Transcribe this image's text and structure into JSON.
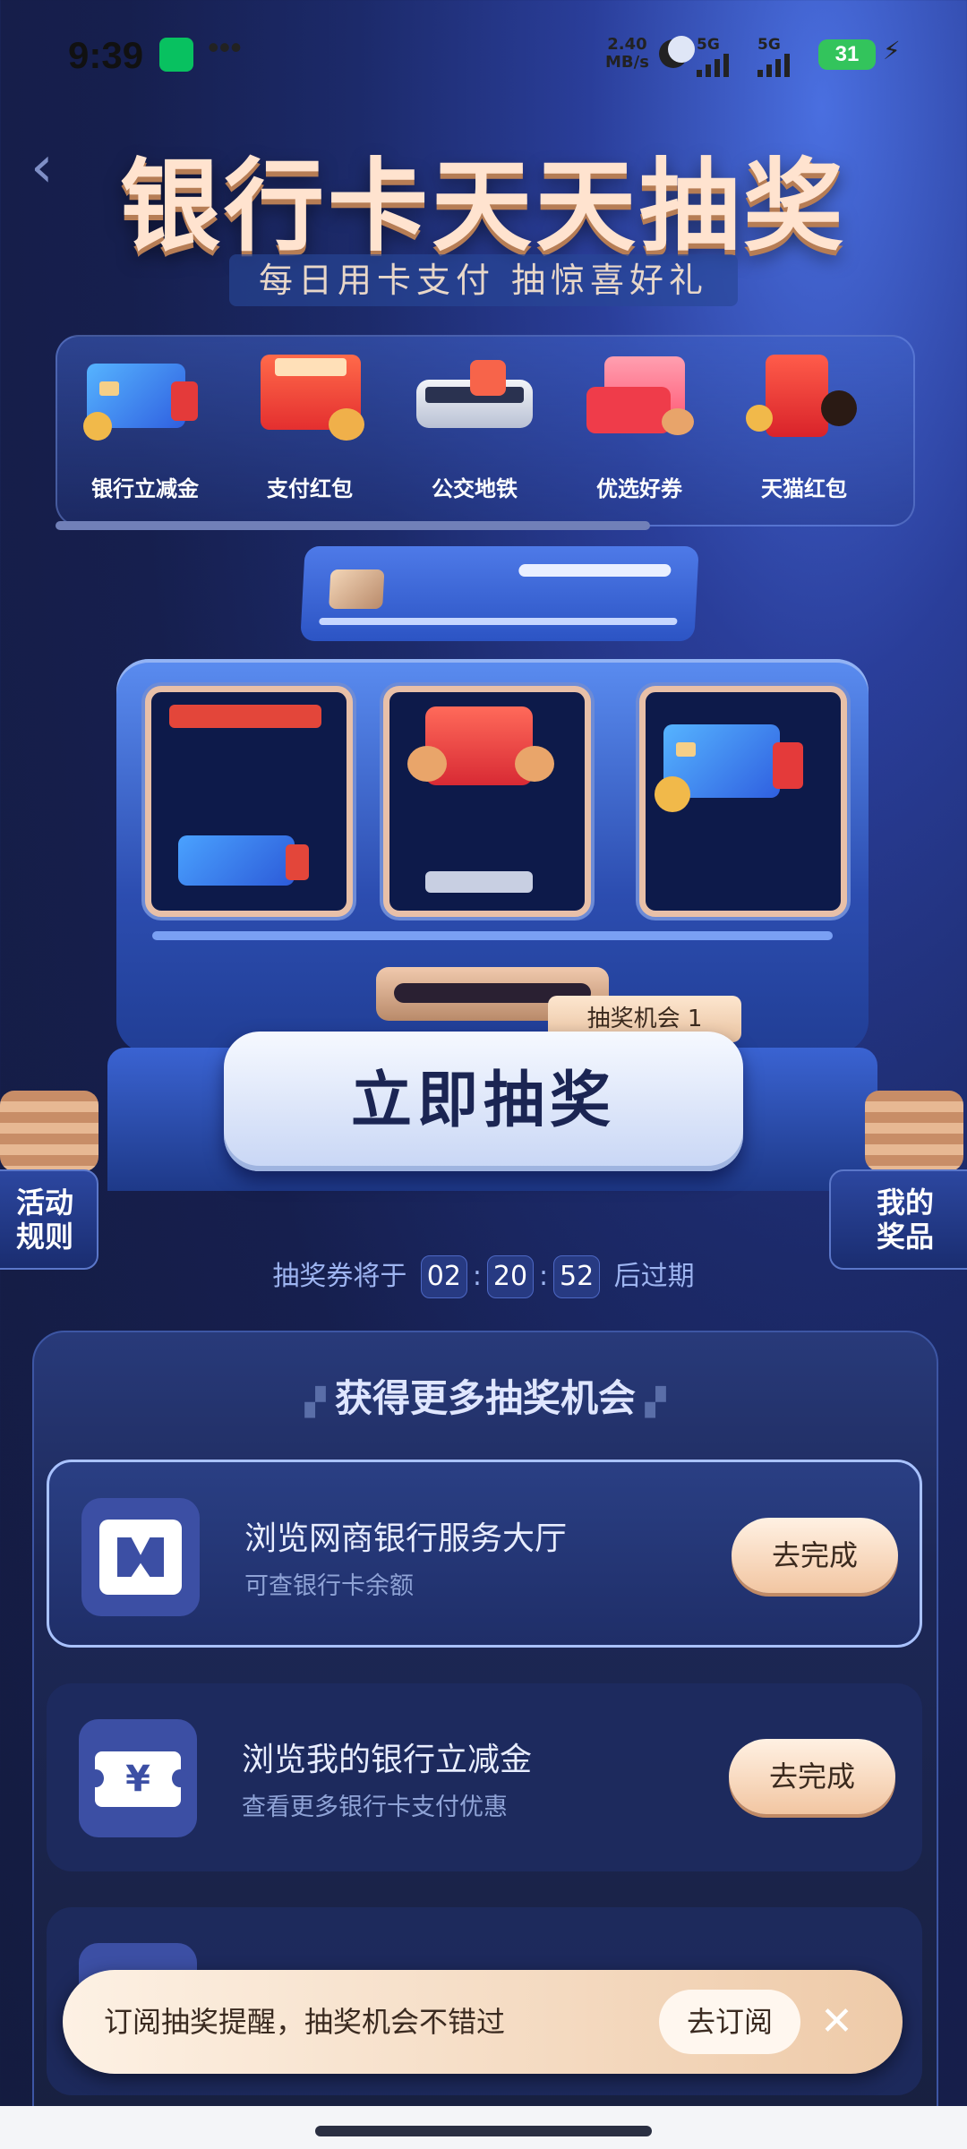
{
  "status": {
    "time": "9:39",
    "net_speed_value": "2.40",
    "net_speed_unit": "MB/s",
    "sig1": "5G",
    "sig2": "5G",
    "battery": "31"
  },
  "header": {
    "title": "银行卡天天抽奖",
    "subtitle": "每日用卡支付 抽惊喜好礼"
  },
  "categories": [
    {
      "label": "银行立减金",
      "icon": "bank-card-icon"
    },
    {
      "label": "支付红包",
      "icon": "red-envelope-icon"
    },
    {
      "label": "公交地铁",
      "icon": "bus-icon"
    },
    {
      "label": "优选好券",
      "icon": "coupon-icon"
    },
    {
      "label": "天猫红包",
      "icon": "tmall-envelope-icon"
    }
  ],
  "lottery": {
    "chance_label": "抽奖机会 1",
    "draw_button": "立即抽奖",
    "rules_button": "活动\n规则",
    "prizes_button": "我的\n奖品",
    "countdown_prefix": "抽奖券将于",
    "countdown_hours": "02",
    "countdown_minutes": "20",
    "countdown_seconds": "52",
    "countdown_suffix": "后过期",
    "colon": ":"
  },
  "tasks_panel": {
    "title": "获得更多抽奖机会",
    "tasks": [
      {
        "name": "浏览网商银行服务大厅",
        "desc": "可查银行卡余额",
        "button": "去完成",
        "icon": "mybank-logo-icon"
      },
      {
        "name": "浏览我的银行立减金",
        "desc": "查看更多银行卡支付优惠",
        "button": "去完成",
        "icon": "yuan-ticket-icon"
      }
    ]
  },
  "subscribe": {
    "text": "订阅抽奖提醒，抽奖机会不错过",
    "button": "去订阅",
    "close": "✕"
  },
  "colors": {
    "accent_gold": "#f2c6a2",
    "deep_blue": "#141b3f",
    "mid_blue": "#2c54c4"
  }
}
